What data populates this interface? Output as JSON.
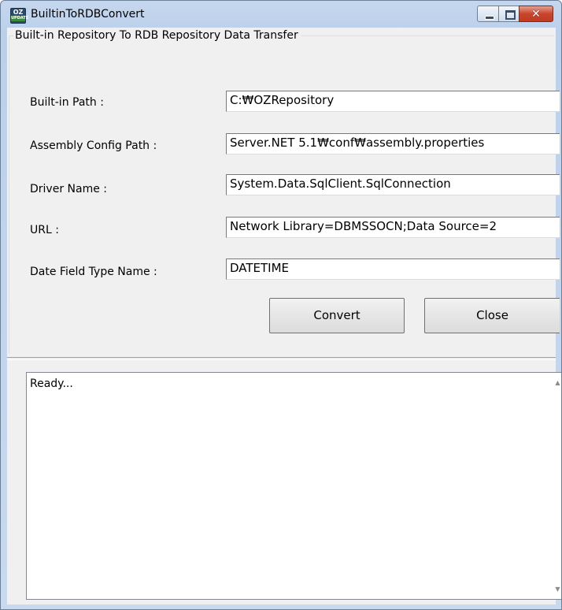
{
  "window": {
    "title": "BuiltinToRDBConvert",
    "icon": "oz-app-icon",
    "icon_text_top": "OZ",
    "icon_text_bottom": "UPDATE"
  },
  "group": {
    "legend": "Built-in Repository To RDB Repository Data Transfer"
  },
  "fields": [
    {
      "label": "Built-in Path :",
      "value": "C:₩OZRepository"
    },
    {
      "label": "Assembly Config Path :",
      "value": "Server.NET 5.1₩conf₩assembly.properties"
    },
    {
      "label": "Driver Name :",
      "value": "System.Data.SqlClient.SqlConnection"
    },
    {
      "label": "URL :",
      "value": "Network Library=DBMSSOCN;Data Source=2"
    },
    {
      "label": "Date Field Type Name :",
      "value": "DATETIME"
    }
  ],
  "buttons": {
    "convert": "Convert",
    "close": "Close"
  },
  "log": {
    "text": "Ready..."
  },
  "colors": {
    "close_button": "#c8452d",
    "titlebar": "#bcd0ea"
  }
}
